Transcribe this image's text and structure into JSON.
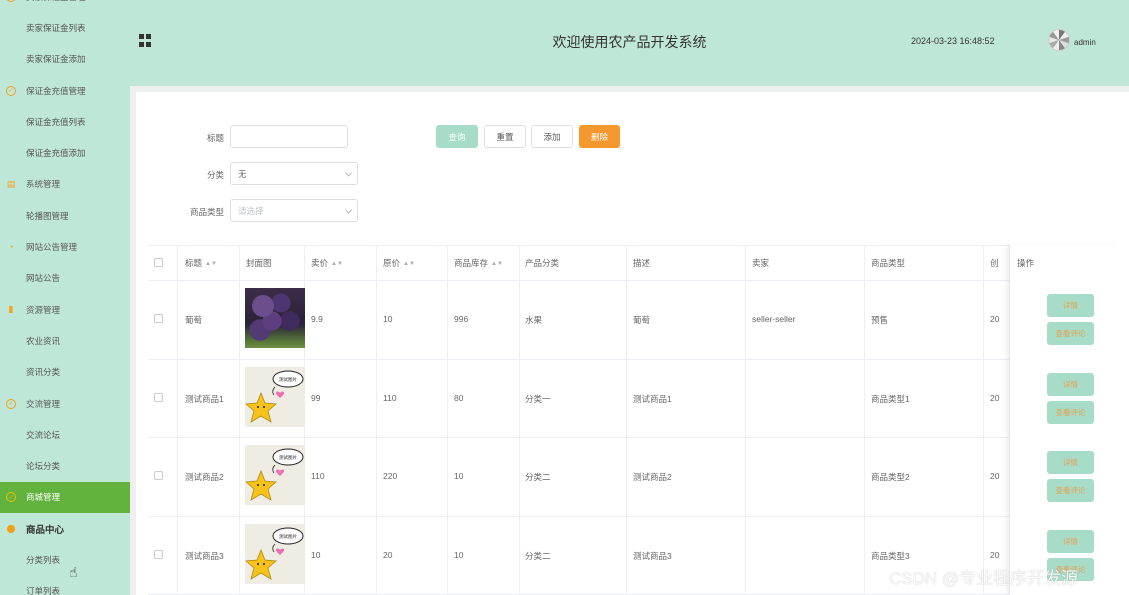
{
  "sidebar": {
    "items": [
      {
        "label": "卖家保证金管理",
        "type": "top",
        "icon": "circle-check-icon"
      },
      {
        "label": "卖家保证金列表",
        "type": "sub"
      },
      {
        "label": "卖家保证金添加",
        "type": "sub"
      },
      {
        "label": "保证金充值管理",
        "type": "top",
        "icon": "circle-check-icon"
      },
      {
        "label": "保证金充值列表",
        "type": "sub"
      },
      {
        "label": "保证金充值添加",
        "type": "sub"
      },
      {
        "label": "系统管理",
        "type": "top",
        "icon": "document-icon"
      },
      {
        "label": "轮播图管理",
        "type": "sub"
      },
      {
        "label": "网站公告管理",
        "type": "top",
        "icon": "chat-icon"
      },
      {
        "label": "网站公告",
        "type": "sub"
      },
      {
        "label": "资源管理",
        "type": "top",
        "icon": "bar-chart-icon"
      },
      {
        "label": "农业资讯",
        "type": "sub"
      },
      {
        "label": "资讯分类",
        "type": "sub"
      },
      {
        "label": "交流管理",
        "type": "top",
        "icon": "circle-check-icon"
      },
      {
        "label": "交流论坛",
        "type": "sub"
      },
      {
        "label": "论坛分类",
        "type": "sub"
      },
      {
        "label": "商城管理",
        "type": "top",
        "icon": "circle-check-icon",
        "active": true
      },
      {
        "label": "商品中心",
        "type": "top",
        "icon": "location-pin-icon",
        "bold": true
      },
      {
        "label": "分类列表",
        "type": "sub"
      },
      {
        "label": "订单列表",
        "type": "sub"
      }
    ]
  },
  "header": {
    "title": "欢迎使用农产品开发系统",
    "datetime": "2024-03-23 16:48:52",
    "username": "admin"
  },
  "search": {
    "title_label": "标题",
    "category_label": "分类",
    "category_value": "无",
    "product_type_label": "商品类型",
    "product_type_placeholder": "请选择"
  },
  "toolbar": {
    "query_label": "查询",
    "reset_label": "重置",
    "add_label": "添加",
    "delete_label": "删除"
  },
  "table": {
    "headers": [
      "标题",
      "封面图",
      "卖价",
      "原价",
      "商品库存",
      "产品分类",
      "描述",
      "卖家",
      "商品类型",
      "创",
      "操作"
    ],
    "rows": [
      {
        "title": "葡萄",
        "price": "9.9",
        "original_price": "10",
        "stock": "996",
        "category": "水果",
        "description": "葡萄",
        "seller": "seller-seller",
        "product_type": "预售",
        "created": "20",
        "thumb": "grape"
      },
      {
        "title": "测试商品1",
        "price": "99",
        "original_price": "110",
        "stock": "80",
        "category": "分类一",
        "description": "测试商品1",
        "seller": "",
        "product_type": "商品类型1",
        "created": "20",
        "thumb": "star"
      },
      {
        "title": "测试商品2",
        "price": "110",
        "original_price": "220",
        "stock": "10",
        "category": "分类二",
        "description": "测试商品2",
        "seller": "",
        "product_type": "商品类型2",
        "created": "20",
        "thumb": "star"
      },
      {
        "title": "测试商品3",
        "price": "10",
        "original_price": "20",
        "stock": "10",
        "category": "分类二",
        "description": "测试商品3",
        "seller": "",
        "product_type": "商品类型3",
        "created": "20",
        "thumb": "star"
      }
    ],
    "actions": [
      "详情",
      "查看评论"
    ],
    "thumb_speech_text": "测试图片"
  },
  "watermark": "CSDN @专业程序开发源",
  "colors": {
    "sidebar_bg": "#bfe7d8",
    "active_menu": "#61b33d",
    "primary_button": "#a6dcc8",
    "delete_button": "#f5982e",
    "action_text": "#e8a050"
  }
}
